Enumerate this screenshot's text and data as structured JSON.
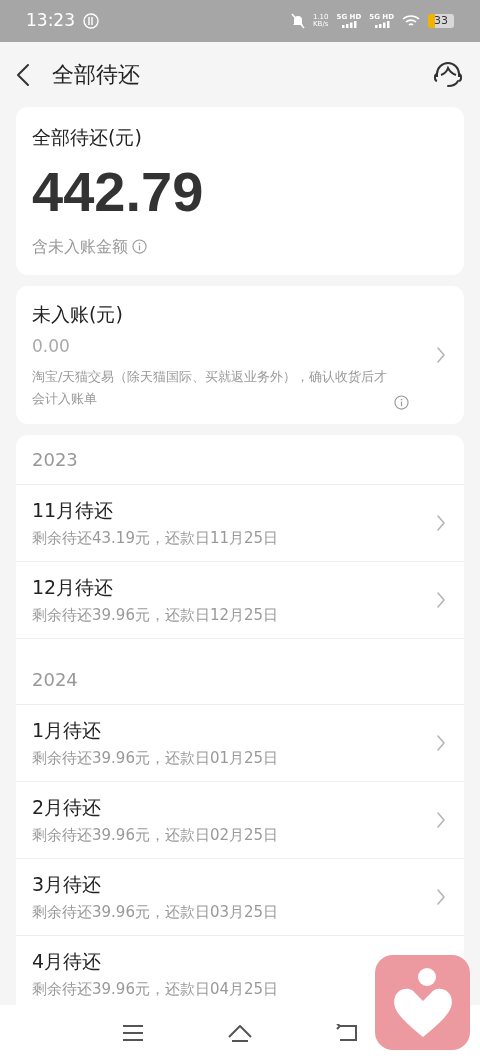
{
  "status_bar": {
    "time": "13:23",
    "net_speed": "1.10",
    "net_unit": "KB/s",
    "signals": [
      "5G HD",
      "5G HD"
    ],
    "battery": "33"
  },
  "header": {
    "title": "全部待还"
  },
  "total_card": {
    "label": "全部待还(元)",
    "amount": "442.79",
    "note": "含未入账金额"
  },
  "pending_card": {
    "label": "未入账(元)",
    "amount": "0.00",
    "note": "淘宝/天猫交易（除天猫国际、买就返业务外），确认收货后才会计入账单"
  },
  "years": [
    {
      "year": "2023",
      "items": [
        {
          "title": "11月待还",
          "detail": "剩余待还43.19元，还款日11月25日"
        },
        {
          "title": "12月待还",
          "detail": "剩余待还39.96元，还款日12月25日"
        }
      ]
    },
    {
      "year": "2024",
      "items": [
        {
          "title": "1月待还",
          "detail": "剩余待还39.96元，还款日01月25日"
        },
        {
          "title": "2月待还",
          "detail": "剩余待还39.96元，还款日02月25日"
        },
        {
          "title": "3月待还",
          "detail": "剩余待还39.96元，还款日03月25日"
        },
        {
          "title": "4月待还",
          "detail": "剩余待还39.96元，还款日04月25日"
        }
      ]
    }
  ]
}
